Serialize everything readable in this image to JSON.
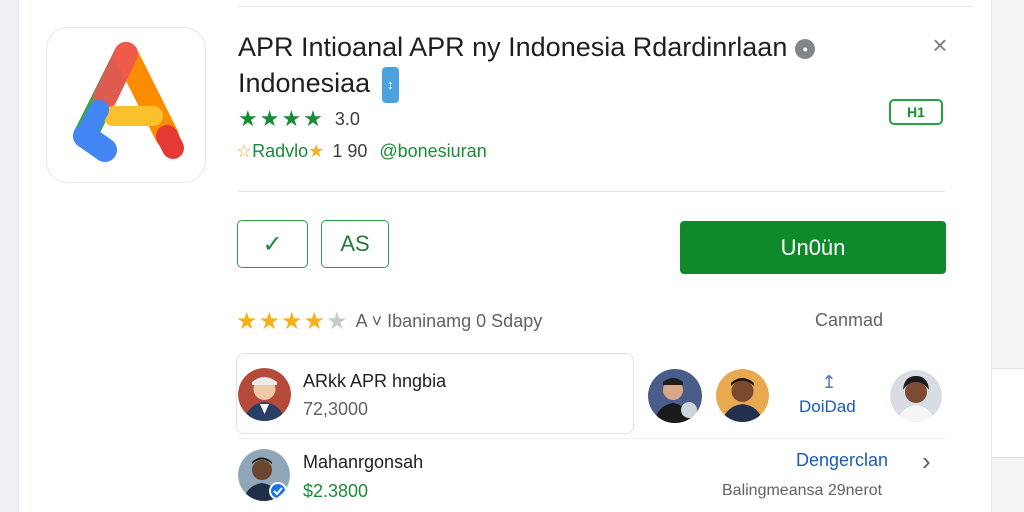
{
  "app": {
    "title_line1": "APR Intioanal APR ny Indonesia Rdardinrlaan",
    "title_line2": "Indonesiaa",
    "badge": "↕",
    "rating_value": "3.0",
    "rating_stars": 4,
    "tag_label": "H1"
  },
  "meta": {
    "label": "Radvlo",
    "count": "1 90",
    "handle": "@bonesiuran"
  },
  "actions": {
    "check_label": "✓",
    "as_label": "AS",
    "primary_label": "Un0ün"
  },
  "reviews": {
    "stars": 4,
    "summary": "A ˅ Ibaninamg 0 Sdapy",
    "cancel_label": "Canmad"
  },
  "users": [
    {
      "name": "ARkk APR hngbia",
      "amount": "72,3000"
    },
    {
      "name": "Mahanrgonsah",
      "amount": "$2.3800"
    }
  ],
  "side_action": {
    "label": "DoiDad"
  },
  "row2": {
    "link_label": "Dengerclan",
    "chevron": "›",
    "subtext": "Balingmeansa 29nerot"
  },
  "colors": {
    "accent_green": "#0f8a2a",
    "link_blue": "#1a5bb8",
    "star_yellow": "#f6b01e"
  }
}
